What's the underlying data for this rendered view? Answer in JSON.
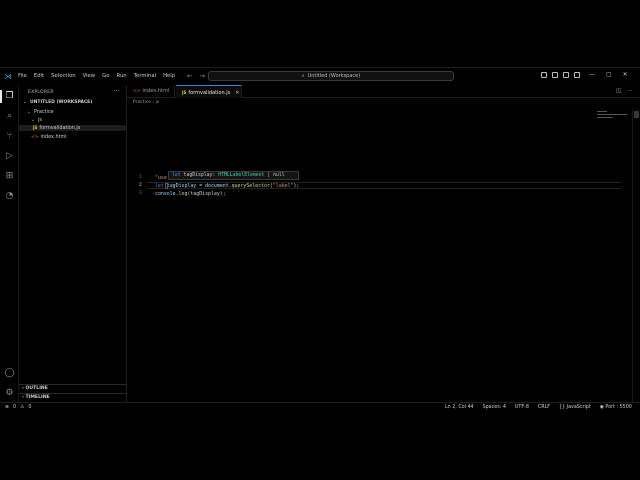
{
  "menu": [
    "File",
    "Edit",
    "Selection",
    "View",
    "Go",
    "Run",
    "Terminal",
    "Help"
  ],
  "command_center": "Untitled (Workspace)",
  "explorer": {
    "header": "EXPLORER",
    "workspace": "UNTITLED (WORKSPACE)",
    "folder": "Practice",
    "subfolder": "js",
    "file_js": "formvalidation.js",
    "file_html": "index.html",
    "outline": "OUTLINE",
    "timeline": "TIMELINE"
  },
  "tabs": [
    {
      "label": "index.html",
      "active": false
    },
    {
      "label": "formvalidation.js",
      "active": true
    }
  ],
  "breadcrumb": {
    "folder": "Practice",
    "sep1": "›",
    "segment": "js"
  },
  "editor": {
    "line_numbers": [
      "1",
      "2",
      "3"
    ],
    "line1": "\"use",
    "line2_kw": "let",
    "line2_var": "tagDisplay",
    "line2_eq": " = ",
    "line2_obj": "document",
    "line2_dot": ".",
    "line2_fn": "querySelector",
    "line2_open": "(",
    "line2_str": "\"label\"",
    "line2_close": ");",
    "line3_obj": "console",
    "line3_dot": ".",
    "line3_fn": "log",
    "line3_args": "(tagDisplay);",
    "hover_kw": "let",
    "hover_name": " tagDisplay: ",
    "hover_type": "HTMLLabelElement",
    "hover_rest": " | null"
  },
  "status": {
    "errors": "0",
    "warnings": "0",
    "position": "Ln 2, Col 44",
    "spaces": "Spaces: 4",
    "encoding": "UTF-8",
    "eol": "CRLF",
    "language": "JavaScript",
    "port": "Port : 5500"
  },
  "colors": {
    "accent": "#4b7bd6",
    "keyword": "#4c8ad6",
    "string": "#ce9178",
    "function": "#d7d78a",
    "js_badge": "#d6c84a"
  }
}
